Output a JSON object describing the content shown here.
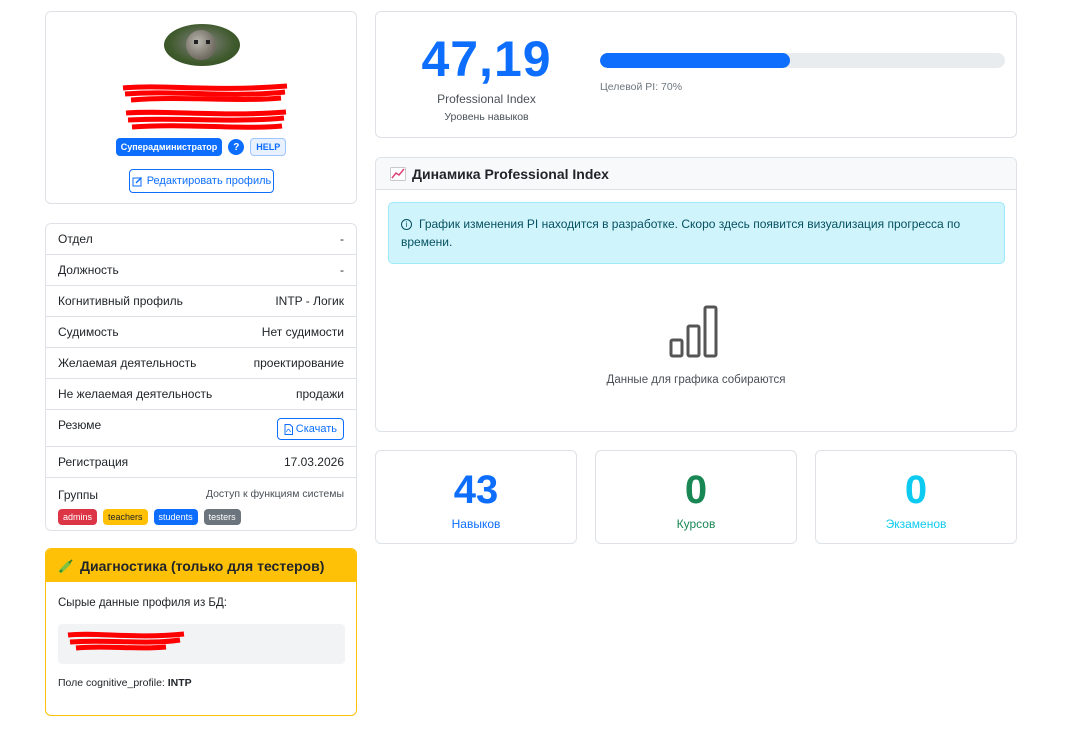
{
  "profile": {
    "role_badge": "Суперадминистратор",
    "help_icon": "?",
    "help_label": "HELP",
    "edit_label": "Редактировать профиль"
  },
  "info": {
    "rows": [
      {
        "label": "Отдел",
        "value": "-"
      },
      {
        "label": "Должность",
        "value": "-"
      },
      {
        "label": "Когнитивный профиль",
        "value": "INTP - Логик"
      },
      {
        "label": "Судимость",
        "value": "Нет судимости"
      },
      {
        "label": "Желаемая деятельность",
        "value": "проектирование"
      },
      {
        "label": "Не желаемая деятельность",
        "value": "продажи"
      }
    ],
    "resume_label": "Резюме",
    "download_label": "Скачать",
    "registration_label": "Регистрация",
    "registration_value": "17.03.2026",
    "groups_label": "Группы",
    "groups_note": "Доступ к функциям системы",
    "groups": [
      {
        "name": "admins",
        "color": "#dc3545"
      },
      {
        "name": "teachers",
        "color": "#ffc107"
      },
      {
        "name": "students",
        "color": "#0d6efd"
      },
      {
        "name": "testers",
        "color": "#6c757d"
      }
    ]
  },
  "diagnostics": {
    "title": "Диагностика (только для тестеров)",
    "raw_label": "Сырые данные профиля из БД:",
    "field_prefix": "Поле cognitive_profile: ",
    "field_value": "INTP"
  },
  "pi": {
    "value": "47,19",
    "label": "Professional Index",
    "sublabel": "Уровень навыков",
    "progress": 0.47,
    "target": "Целевой PI: 70%"
  },
  "chart_section": {
    "title": "Динамика Professional Index",
    "alert": "График изменения PI находится в разработке. Скоро здесь появится визуализация прогресса по времени.",
    "empty_text": "Данные для графика собираются"
  },
  "stats": {
    "skills": {
      "value": "43",
      "label": "Навыков",
      "color": "#0d6efd"
    },
    "courses": {
      "value": "0",
      "label": "Курсов",
      "color": "#198754"
    },
    "exams": {
      "value": "0",
      "label": "Экзаменов",
      "color": "#0dcaf0"
    }
  }
}
